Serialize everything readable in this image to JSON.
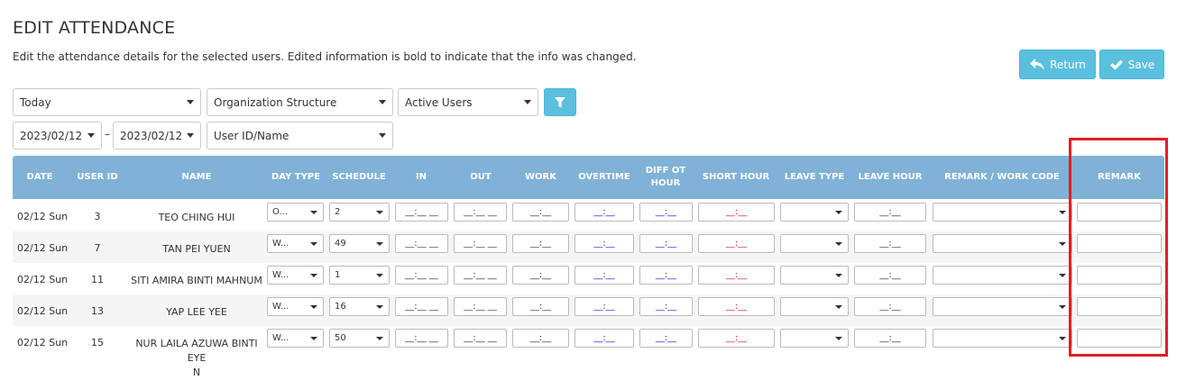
{
  "page": {
    "title": "EDIT ATTENDANCE",
    "description": "Edit the attendance details for the selected users. Edited information is bold to indicate that the info was changed."
  },
  "actions": {
    "return_label": "Return",
    "save_label": "Save"
  },
  "filters": {
    "period": "Today",
    "organization": "Organization Structure",
    "user_status": "Active Users",
    "date_from": "2023/02/12",
    "date_separator": "–",
    "date_to": "2023/02/12",
    "user_search": "User ID/Name"
  },
  "table": {
    "headers": {
      "date": "DATE",
      "user_id": "USER ID",
      "name": "NAME",
      "day_type": "DAY TYPE",
      "schedule": "SCHEDULE",
      "in": "IN",
      "out": "OUT",
      "work": "WORK",
      "overtime": "OVERTIME",
      "diff_ot_1": "DIFF OT",
      "diff_ot_2": "HOUR",
      "short_hour": "SHORT HOUR",
      "leave_type": "LEAVE TYPE",
      "leave_hour": "LEAVE HOUR",
      "remark_work_code": "REMARK / WORK CODE",
      "remark": "REMARK"
    },
    "masks": {
      "time": "__:__ __",
      "duration": "__:__"
    },
    "rows": [
      {
        "date": "02/12 Sun",
        "user_id": "3",
        "name": "TEO CHING HUI",
        "name_cont": "",
        "day_type": "O...",
        "schedule": "2"
      },
      {
        "date": "02/12 Sun",
        "user_id": "7",
        "name": "TAN PEI YUEN",
        "name_cont": "",
        "day_type": "W...",
        "schedule": "49"
      },
      {
        "date": "02/12 Sun",
        "user_id": "11",
        "name": "SITI AMIRA BINTI MAHNUM",
        "name_cont": "",
        "day_type": "W...",
        "schedule": "1"
      },
      {
        "date": "02/12 Sun",
        "user_id": "13",
        "name": "YAP LEE YEE",
        "name_cont": "",
        "day_type": "W...",
        "schedule": "16"
      },
      {
        "date": "02/12 Sun",
        "user_id": "15",
        "name": "NUR LAILA AZUWA BINTI EYE",
        "name_cont": "N",
        "day_type": "W...",
        "schedule": "50"
      }
    ]
  },
  "colors": {
    "header_bg": "#7fb2d6",
    "button_bg": "#5bc0de",
    "highlight": "#e31e24",
    "overtime_text": "#1a1ad6",
    "short_hour_text": "#d61a1a"
  }
}
